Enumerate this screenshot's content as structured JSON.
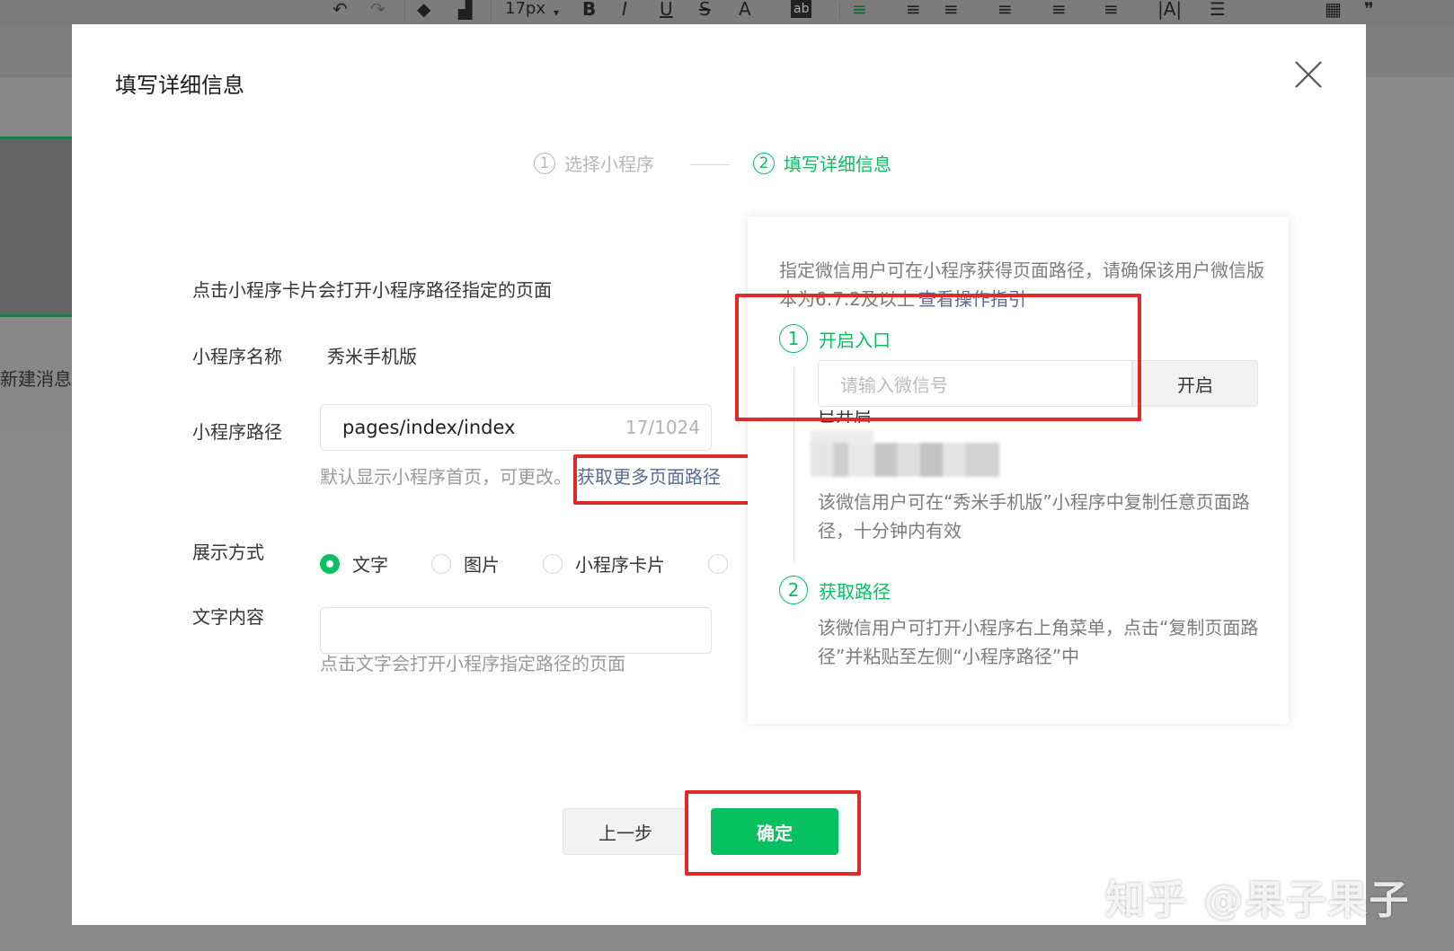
{
  "toolbar": {
    "font_size": "17px",
    "items": [
      "undo-icon",
      "redo-icon",
      "format-brush-icon",
      "clear-format-icon",
      "bold-icon",
      "italic-icon",
      "underline-icon",
      "strikethrough-icon",
      "font-color-icon",
      "background-color-icon",
      "align-left-icon",
      "indent-icon",
      "outdent-icon",
      "align-center-icon",
      "align-right-icon",
      "line-height-icon",
      "letter-spacing-icon",
      "list-icon",
      "table-icon",
      "quote-icon"
    ]
  },
  "background": {
    "new_message": "新建消息"
  },
  "dialog": {
    "title": "填写详细信息",
    "steps": [
      {
        "num": "1",
        "label": "选择小程序"
      },
      {
        "num": "2",
        "label": "填写详细信息"
      }
    ],
    "intro": "点击小程序卡片会打开小程序路径指定的页面",
    "name_label": "小程序名称",
    "name_value": "秀米手机版",
    "path_label": "小程序路径",
    "path_value": "pages/index/index",
    "path_count": "17/1024",
    "path_hint": "默认显示小程序首页，可更改。",
    "path_link": "获取更多页面路径",
    "display_label": "展示方式",
    "display_options": [
      {
        "label": "文字",
        "checked": true
      },
      {
        "label": "图片",
        "checked": false
      },
      {
        "label": "小程序卡片",
        "checked": false
      },
      {
        "label": "",
        "checked": false
      }
    ],
    "text_label": "文字内容",
    "text_value": "",
    "text_hint": "点击文字会打开小程序指定路径的页面",
    "prev_button": "上一步",
    "ok_button": "确定"
  },
  "panel": {
    "desc_prefix": "指定微信用户可在小程序获得页面路径，请确保该用户微信版本为6.7.2及以上",
    "desc_link": "查看操作指引",
    "step1_num": "1",
    "step1_title": "开启入口",
    "wx_placeholder": "请输入微信号",
    "open_button": "开启",
    "opened_label": "已开启",
    "step1_text": "该微信用户可在“秀米手机版”小程序中复制任意页面路径，十分钟内有效",
    "step2_num": "2",
    "step2_title": "获取路径",
    "step2_text": "该微信用户可打开小程序右上角菜单，点击“复制页面路径”并粘贴至左侧“小程序路径”中"
  },
  "watermark": "知乎 @果子果子",
  "colors": {
    "accent": "#07c160",
    "link": "#576b95",
    "highlight": "#e02a2a"
  }
}
